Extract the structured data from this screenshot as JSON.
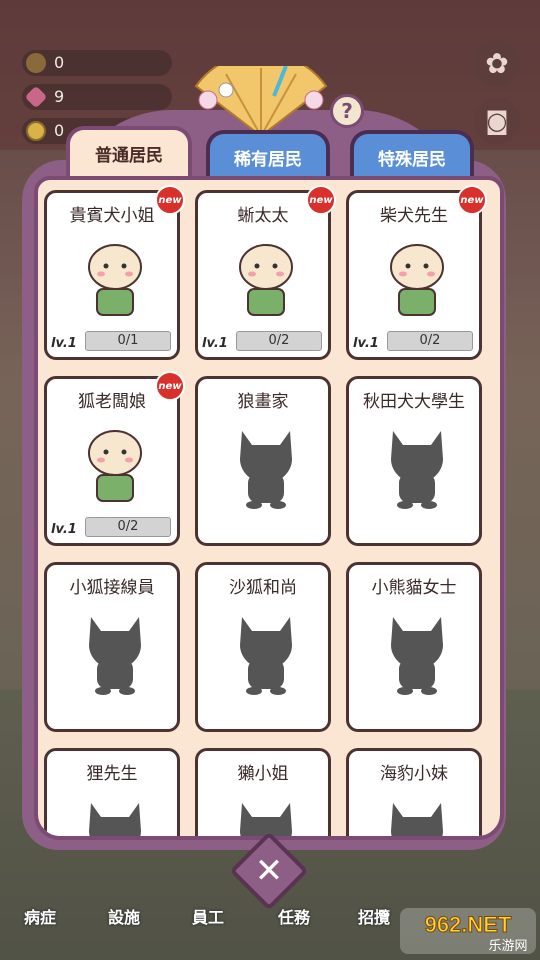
{
  "counters": [
    {
      "value": "0"
    },
    {
      "value": "9"
    },
    {
      "value": "0"
    }
  ],
  "tabs": {
    "common": "普通居民",
    "rare": "稀有居民",
    "special": "特殊居民"
  },
  "help": "?",
  "new_label": "new",
  "lv_label": "lv.1",
  "residents": [
    {
      "name": "貴賓犬小姐",
      "progress": "0/1",
      "unlocked": true,
      "new": true
    },
    {
      "name": "蜥太太",
      "progress": "0/2",
      "unlocked": true,
      "new": true
    },
    {
      "name": "柴犬先生",
      "progress": "0/2",
      "unlocked": true,
      "new": true
    },
    {
      "name": "狐老闆娘",
      "progress": "0/2",
      "unlocked": true,
      "new": true
    },
    {
      "name": "狼畫家",
      "unlocked": false
    },
    {
      "name": "秋田犬大學生",
      "unlocked": false
    },
    {
      "name": "小狐接線員",
      "unlocked": false
    },
    {
      "name": "沙狐和尚",
      "unlocked": false
    },
    {
      "name": "小熊貓女士",
      "unlocked": false
    },
    {
      "name": "狸先生",
      "unlocked": false
    },
    {
      "name": "獺小姐",
      "unlocked": false
    },
    {
      "name": "海豹小妹",
      "unlocked": false
    }
  ],
  "close": "✕",
  "bottom_nav": [
    "病症",
    "設施",
    "員工",
    "任務",
    "招攬"
  ],
  "watermark": {
    "brand": "962.NET",
    "sub": "乐游网"
  },
  "colors": {
    "panel": "#8e5f86",
    "content": "#fbe6d3",
    "tab_inactive": "#5a8fd8",
    "new_badge": "#d9302c"
  }
}
